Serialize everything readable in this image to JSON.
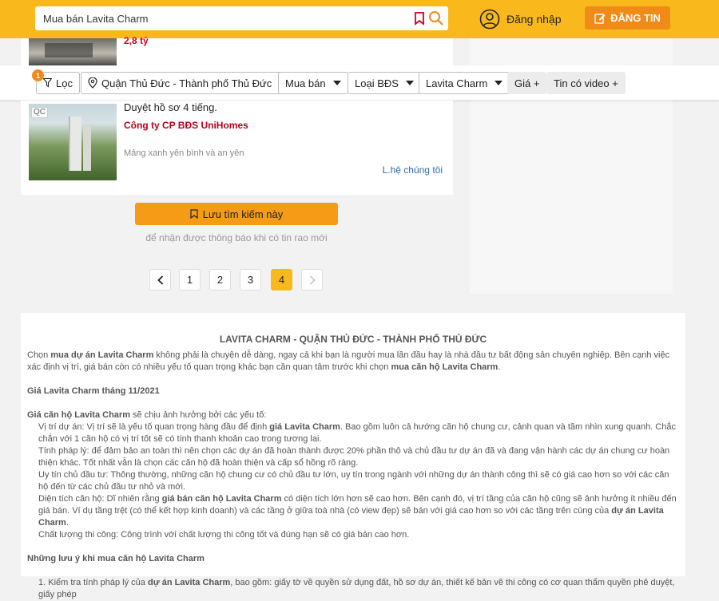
{
  "header": {
    "search_value": "Mua bán Lavita Charm",
    "login_label": "Đăng nhập",
    "post_label": "ĐĂNG TIN",
    "accent": "#f9b91c"
  },
  "listing_top": {
    "price": "2,8 tỷ"
  },
  "filters": {
    "badge": "1",
    "loc_label": "Lọc",
    "location": "Quận Thủ Đức - Thành phố Thủ Đức",
    "type": "Mua bán",
    "category": "Loại BĐS",
    "project": "Lavita Charm",
    "price": "Giá +",
    "video": "Tin có video +"
  },
  "ad": {
    "tag": "QC",
    "title": "Duyệt hồ sơ 4 tiếng.",
    "company": "Công ty CP BĐS UniHomes",
    "slogan": "Mảng xanh yên bình và an yên",
    "contact": "L.hệ chúng tôi"
  },
  "save_search": {
    "label": "Lưu tìm kiếm này",
    "hint": "để nhận được thông báo khi có tin rao mới"
  },
  "pagination": {
    "pages": [
      "1",
      "2",
      "3",
      "4"
    ],
    "active": "4"
  },
  "article": {
    "title": "LAVITA CHARM - QUẬN THỦ ĐỨC - THÀNH PHỐ THỦ ĐỨC",
    "intro_1": "Chọn ",
    "intro_b1": "mua dự án Lavita Charm",
    "intro_2": " không phải là chuyện dễ dàng, ngay cả khi bạn là người mua lần đầu hay là nhà đầu tư bất động sản chuyên nghiệp. Bên cạnh việc xác định vị trí, giá bán còn có nhiều yếu tố quan trọng khác bạn cần quan tâm trước khi chọn ",
    "intro_b2": "mua căn hộ Lavita Charm",
    "intro_3": ".",
    "h1": "Giá Lavita Charm tháng 11/2021",
    "p1_b": "Giá căn hộ Lavita Charm",
    "p1": " sẽ chịu ảnh hưởng bởi các yếu tố:",
    "i1a": "Vị trí dự án: Vị trí sẽ là yếu tố quan trọng hàng đầu để định ",
    "i1b": "giá Lavita Charm",
    "i1c": ". Bao gồm luôn cả hướng căn hộ chung cư, cảnh quan và tầm nhìn xung quanh. Chắc chắn với 1 căn hộ có vị trí tốt sẽ có tính thanh khoản cao trong tương lai.",
    "i2": "Tính pháp lý: để đảm bảo an toàn thì nên chọn các dự án đã hoàn thành được 20% phần thô và chủ đầu tư dự án đã và đang vận hành các dự án chung cư hoàn thiện khác. Tốt nhất vẫn là chọn các căn hộ đã hoàn thiện và cấp sổ hồng rõ ràng.",
    "i3": "Uy tín chủ đầu tư: Thông thường, những căn hộ chung cư có chủ đầu tư lớn, uy tín trong ngành với những dự án thành công thì sẽ có giá cao hơn so với các căn hộ đến từ các chủ đầu tư nhỏ và mới.",
    "i4a": "Diện tích căn hộ: Dĩ nhiên rằng ",
    "i4b": "giá bán căn hộ Lavita Charm",
    "i4c": " có diện tích lớn hơn sẽ cao hơn. Bên cạnh đó, vị trí tầng của căn hộ cũng sẽ ảnh hưởng ít nhiều đến giá bán. Ví dụ tầng trệt (có thể kết hợp kinh doanh) và các tầng ở giữa toà nhà (có view đẹp) sẽ bán với giá cao hơn so với các tầng trên cùng của ",
    "i4d": "dự án Lavita Charm",
    "i4e": ".",
    "i5": "Chất lượng thi công: Công trình với chất lượng thi công tốt và đúng hạn sẽ có giá bán cao hơn.",
    "h2": "Những lưu ý khi mua căn hộ Lavita Charm",
    "n1a": "1. Kiểm tra tính pháp lý của ",
    "n1b": "dự án Lavita Charm",
    "n1c": ", bao gồm: giấy tờ về quyền sử dụng đất, hồ sơ dự án, thiết kế bản vẽ thi công có cơ quan thẩm quyền phê duyệt, giấy phép"
  }
}
